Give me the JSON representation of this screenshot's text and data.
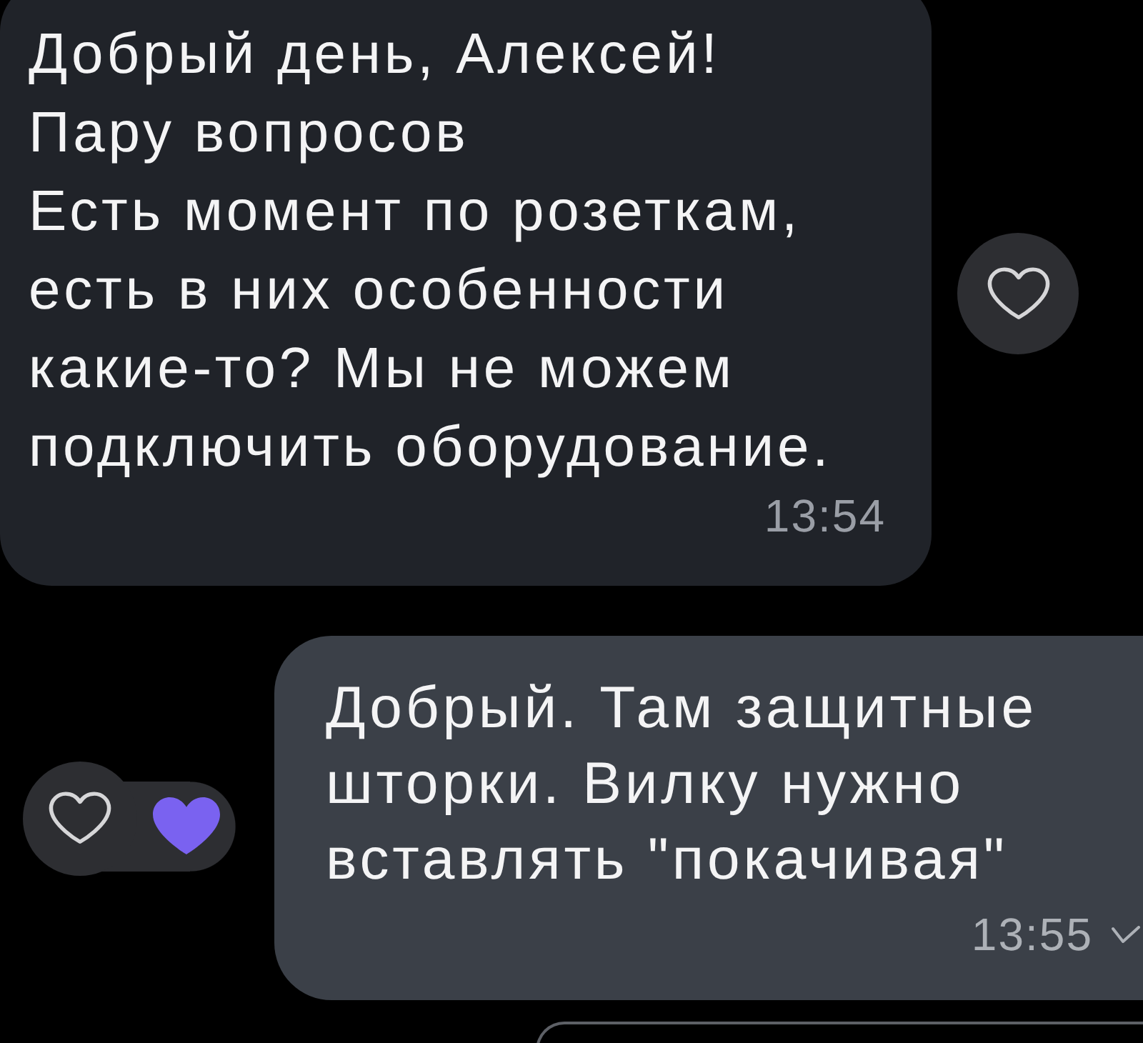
{
  "messages": [
    {
      "kind": "incoming",
      "text": "Добрый день, Алексей!\nПару вопросов\nЕсть момент по розеткам, есть в них особенности какие-то? Мы не можем подключить оборудование.",
      "time": "13:54",
      "liked": false,
      "reacted": false
    },
    {
      "kind": "outgoing",
      "text": "Добрый. Там защитные шторки. Вилку нужно вставлять \"покачивая\"",
      "time": "13:55",
      "liked": false,
      "reacted": true,
      "delivered": true
    },
    {
      "kind": "partial"
    }
  ]
}
